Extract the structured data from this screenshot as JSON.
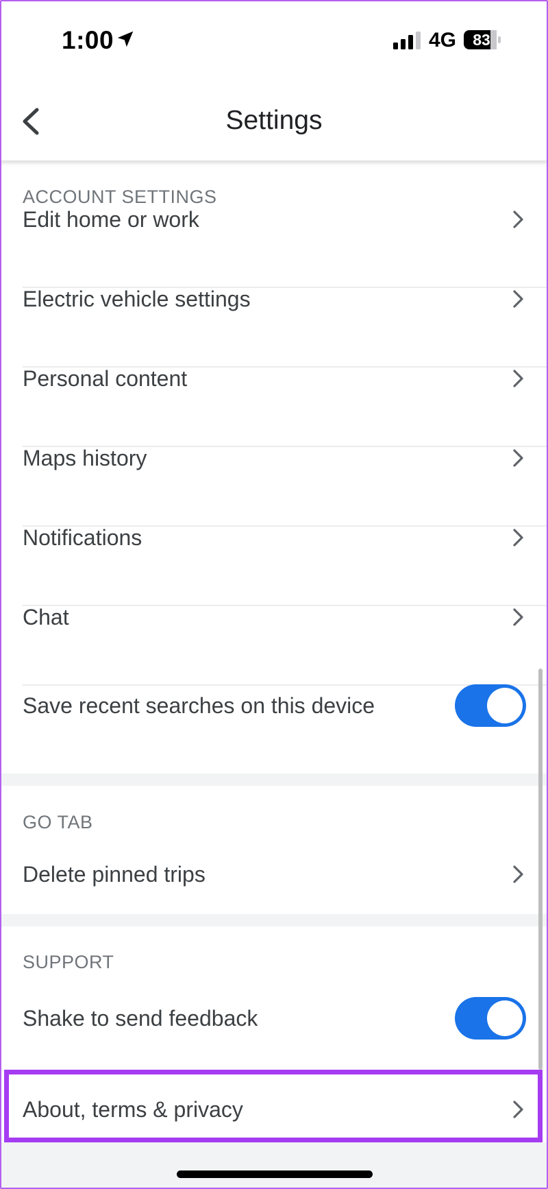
{
  "status_bar": {
    "time": "1:00",
    "network": "4G",
    "battery": "83",
    "icons": [
      "location-arrow-icon",
      "signal-bars-icon",
      "battery-icon"
    ]
  },
  "header": {
    "title": "Settings",
    "back_icon": "chevron-left-icon"
  },
  "sections": {
    "account": {
      "header": "ACCOUNT SETTINGS",
      "items": [
        {
          "label": "Edit home or work"
        },
        {
          "label": "Electric vehicle settings"
        },
        {
          "label": "Personal content"
        },
        {
          "label": "Maps history"
        },
        {
          "label": "Notifications"
        },
        {
          "label": "Chat"
        }
      ],
      "toggle_item": {
        "label": "Save recent searches on this device",
        "on": true
      }
    },
    "go_tab": {
      "header": "GO TAB",
      "items": [
        {
          "label": "Delete pinned trips"
        }
      ]
    },
    "support": {
      "header": "SUPPORT",
      "toggle_item": {
        "label": "Shake to send feedback",
        "on": true
      },
      "items": [
        {
          "label": "About, terms & privacy"
        }
      ]
    }
  },
  "colors": {
    "toggle_on": "#1a73e8",
    "highlight": "#a63cf2",
    "section_header": "#70757a",
    "band": "#f1f3f4"
  }
}
